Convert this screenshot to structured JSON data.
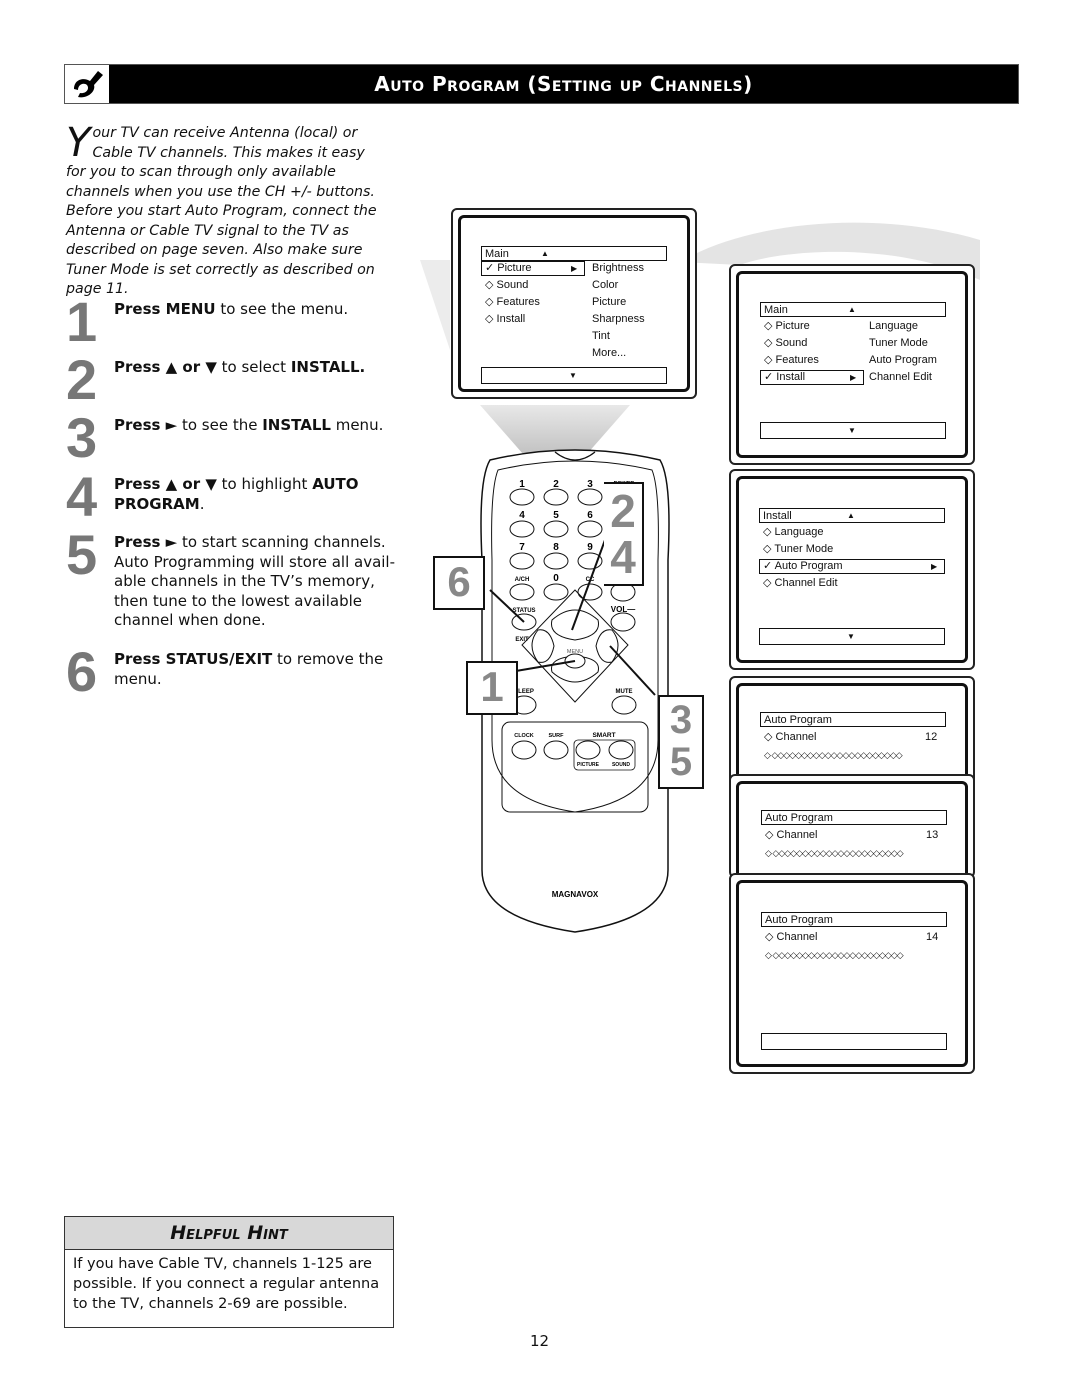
{
  "header": {
    "title": "Auto Program (Setting up Channels)",
    "icon": "remote-hand-icon"
  },
  "intro": {
    "dropcap": "Y",
    "paragraph1": "our TV can receive Antenna (local) or Cable TV channels. This makes it easy for you to scan through only available channels when you use the CH +/- buttons.",
    "paragraph2": "Before you start Auto Program, connect the Antenna or Cable TV signal to the TV as described on page seven. Also make sure Tuner Mode is set correctly as described on page 11."
  },
  "steps": [
    {
      "number": "1",
      "bold1": "Press MENU",
      "text1": " to see the menu.",
      "bold2": "",
      "text2": ""
    },
    {
      "number": "2",
      "bold1": "Press ▲ or ▼",
      "text1": " to select ",
      "bold2": "INSTALL.",
      "text2": ""
    },
    {
      "number": "3",
      "bold1": "Press ►",
      "text1": " to see the ",
      "bold2": "INSTALL",
      "text2": " menu."
    },
    {
      "number": "4",
      "bold1": "Press ▲ or ▼",
      "text1": " to highlight ",
      "bold2": "AUTO PROGRAM",
      "text2": "."
    },
    {
      "number": "5",
      "bold1": "Press ►",
      "text1": " to start scanning channels. Auto Programming will store all avail-able channels in the TV’s memory, then tune to the lowest available channel when done.",
      "bold2": "",
      "text2": ""
    },
    {
      "number": "6",
      "bold1": "Press STATUS/EXIT",
      "text1": " to remove the menu.",
      "bold2": "",
      "text2": ""
    }
  ],
  "hint": {
    "title": "Helpful Hint",
    "body": "If you have Cable TV, channels 1-125 are possible. If you connect a regular antenna to the TV, channels 2-69 are possible."
  },
  "page_number": "12",
  "screens": {
    "main_picture": {
      "header": "Main",
      "items": [
        "Picture",
        "Sound",
        "Features",
        "Install"
      ],
      "selected": "Picture",
      "submenu": [
        "Brightness",
        "Color",
        "Picture",
        "Sharpness",
        "Tint",
        "More..."
      ]
    },
    "main_install": {
      "header": "Main",
      "items": [
        "Picture",
        "Sound",
        "Features",
        "Install"
      ],
      "selected": "Install",
      "submenu": [
        "Language",
        "Tuner Mode",
        "Auto Program",
        "Channel Edit"
      ]
    },
    "install_menu": {
      "header": "Install",
      "items": [
        "Language",
        "Tuner Mode",
        "Auto Program",
        "Channel Edit"
      ],
      "selected": "Auto Program"
    },
    "auto_program": [
      {
        "header": "Auto Program",
        "label": "Channel",
        "channel": "12",
        "dots": "◇  ◇◇◇◇◇◇◇◇◇◇◇◇◇◇◇◇◇◇◇◇◇◇"
      },
      {
        "header": "Auto Program",
        "label": "Channel",
        "channel": "13",
        "dots": "◇  ◇◇◇◇◇◇◇◇◇◇◇◇◇◇◇◇◇◇◇◇◇◇"
      },
      {
        "header": "Auto Program",
        "label": "Channel",
        "channel": "14",
        "dots": "◇  ◇◇◇◇◇◇◇◇◇◇◇◇◇◇◇◇◇◇◇◇◇◇"
      }
    ]
  },
  "remote": {
    "brand": "MAGNAVOX",
    "keys": {
      "k1": "1",
      "k2": "2",
      "k3": "3",
      "power": "POWER",
      "k4": "4",
      "k5": "5",
      "k6": "6",
      "k7": "7",
      "k8": "8",
      "k9": "9",
      "ach": "A/CH",
      "k0": "0",
      "cc": "CC",
      "status": "STATUS",
      "exit": "EXIT",
      "vol": "VOL—",
      "menu": "MENU",
      "sleep": "SLEEP",
      "mute": "MUTE",
      "clock": "CLOCK",
      "surf": "SURF",
      "smart": "SMART",
      "picture": "PICTURE",
      "sound": "SOUND"
    },
    "callouts": {
      "c24_top": "2",
      "c24_bottom": "4",
      "c6": "6",
      "c1": "1",
      "c35_top": "3",
      "c35_bottom": "5"
    }
  }
}
